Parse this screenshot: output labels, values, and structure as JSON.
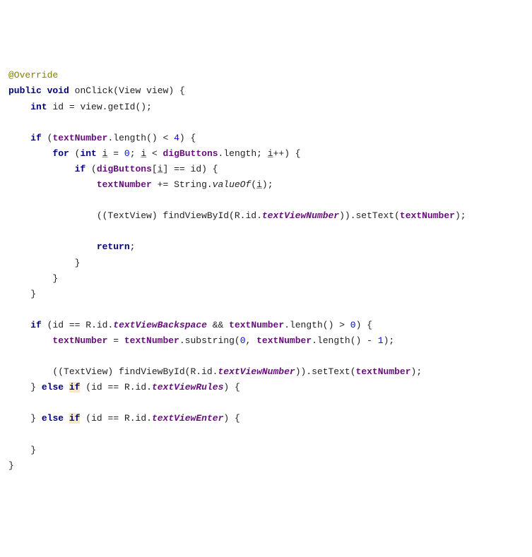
{
  "code": {
    "annotation": "@Override",
    "kw_public": "public",
    "kw_void": "void",
    "method_name": "onClick",
    "param_type": "View",
    "param_name": "view",
    "brace_open": "{",
    "kw_int": "int",
    "var_id": "id",
    "eq": " = ",
    "view_getid": "view.getId();",
    "kw_if": "if",
    "paren_open": "(",
    "field_textNumber": "textNumber",
    "dot_length": ".length() < ",
    "num_4": "4",
    "paren_close_brace": ") {",
    "kw_for": "for",
    "for_open": "(",
    "for_int": "int",
    "var_i": "i",
    "for_init": " = ",
    "num_0": "0",
    "semi": "; ",
    "lt": " < ",
    "field_digButtons": "digButtons",
    "digbuttons_length": ".length",
    "for_inc": "++",
    "inner_if_open": "(",
    "digbuttons_idx_open": "[",
    "digbuttons_idx_close": "]",
    "eqeq": " == ",
    "id_ref": "id",
    "pluseq": " += ",
    "string_class": "String.",
    "valueof": "valueOf",
    "valueof_open": "(",
    "valueof_close": ");",
    "textview_cast": "((TextView) findViewById(R.id.",
    "textViewNumber": "textViewNumber",
    "settext_open": ")).setText(",
    "settext_close": ");",
    "kw_return": "return",
    "return_semi": ";",
    "brace_close": "}",
    "rid_open": "R.id.",
    "textViewBackspace": "textViewBackspace",
    "and": " && ",
    "gt0": ".length() > ",
    "num_0b": "0",
    "substring_open": ".substring(",
    "comma": ", ",
    "length_minus1": ".length() - ",
    "num_1": "1",
    "sub_close": ");",
    "kw_else": "else",
    "textViewRules": "textViewRules",
    "textViewEnter": "textViewEnter"
  }
}
